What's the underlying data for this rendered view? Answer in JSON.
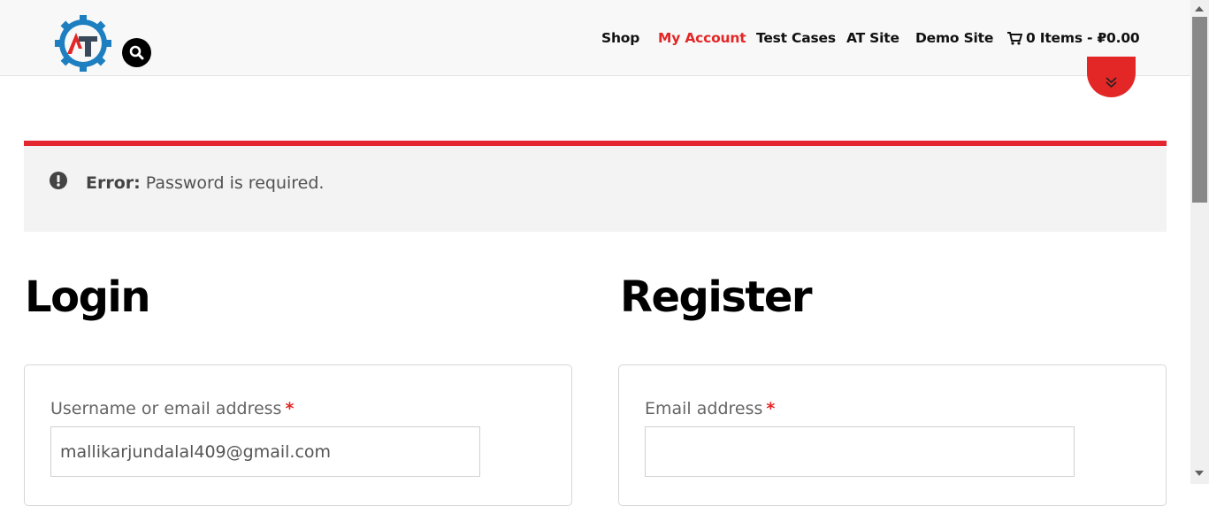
{
  "header": {
    "nav": [
      {
        "label": "Shop",
        "active": false
      },
      {
        "label": "My Account",
        "active": true
      },
      {
        "label": "Test Cases",
        "active": false
      },
      {
        "label": "AT Site",
        "active": false
      },
      {
        "label": "Demo Site",
        "active": false
      }
    ],
    "cart_label": "0 Items - ₽0.00",
    "icons": {
      "logo": "gear-logo-icon",
      "search": "search-icon",
      "cart": "cart-icon",
      "scroll": "chevron-double-down-icon"
    },
    "logo_text": "AT"
  },
  "colors": {
    "accent": "#e32626",
    "error_border": "#e32630",
    "logo_blue": "#1e7fc0",
    "logo_dark": "#3a4a5a"
  },
  "error": {
    "icon": "exclamation-circle-icon",
    "strong": "Error:",
    "message": "Password is required."
  },
  "login": {
    "title": "Login",
    "username_label": "Username or email address",
    "required_mark": "*",
    "username_value": "mallikarjundalal409@gmail.com"
  },
  "register": {
    "title": "Register",
    "email_label": "Email address",
    "required_mark": "*",
    "email_value": ""
  }
}
